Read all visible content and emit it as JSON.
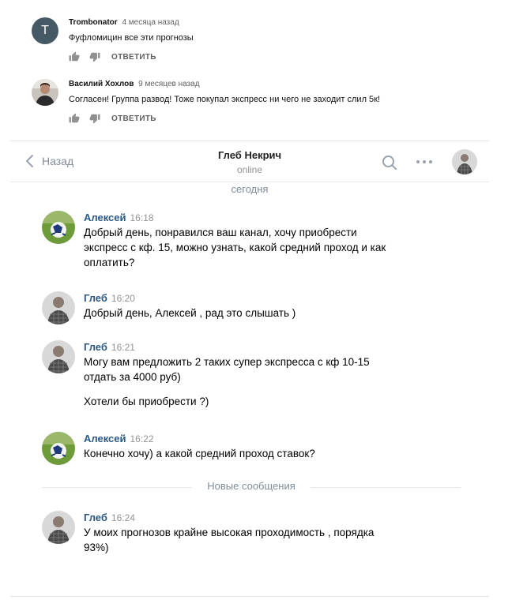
{
  "comments": [
    {
      "avatar_letter": "T",
      "author": "Trombonator",
      "time": "4 месяца назад",
      "text": "Фуфломицин все эти прогнозы",
      "reply_label": "ОТВЕТИТЬ"
    },
    {
      "avatar_letter": "",
      "author": "Василий Хохлов",
      "time": "9 месяцев назад",
      "text": "Согласен! Группа развод! Тоже покупал экспресс ни чего не заходит слил 5к!",
      "reply_label": "ОТВЕТИТЬ"
    }
  ],
  "dialog": {
    "back_label": "Назад",
    "peer_name": "Глеб Некрич",
    "peer_status": "online",
    "day_label": "сегодня",
    "new_messages_label": "Новые сообщения",
    "messages": [
      {
        "author": "Алексей",
        "time": "16:18",
        "lines": [
          "Добрый день, понравился ваш канал, хочу приобрести",
          "экспресс с кф. 15, можно узнать, какой средний проход и как",
          "оплатить?"
        ]
      },
      {
        "author": "Глеб",
        "time": "16:20",
        "lines": [
          "Добрый день, Алексей , рад это слышать )"
        ]
      },
      {
        "author": "Глеб",
        "time": "16:21",
        "lines": [
          "Могу вам предложить 2 таких супер экспресса с кф 10-15",
          "отдать за 4000 руб)"
        ],
        "extra": "Хотели бы приобрести ?)"
      },
      {
        "author": "Алексей",
        "time": "16:22",
        "lines": [
          "Конечно хочу) а какой средний проход ставок?"
        ]
      },
      {
        "author": "Глеб",
        "time": "16:24",
        "lines": [
          "У моих прогнозов крайне высокая проходимость , порядка",
          "93%)"
        ]
      }
    ]
  },
  "colors": {
    "vk_link": "#2a5885",
    "vk_secondary": "#818c99",
    "yt_letter_avatar": "#455a64"
  }
}
